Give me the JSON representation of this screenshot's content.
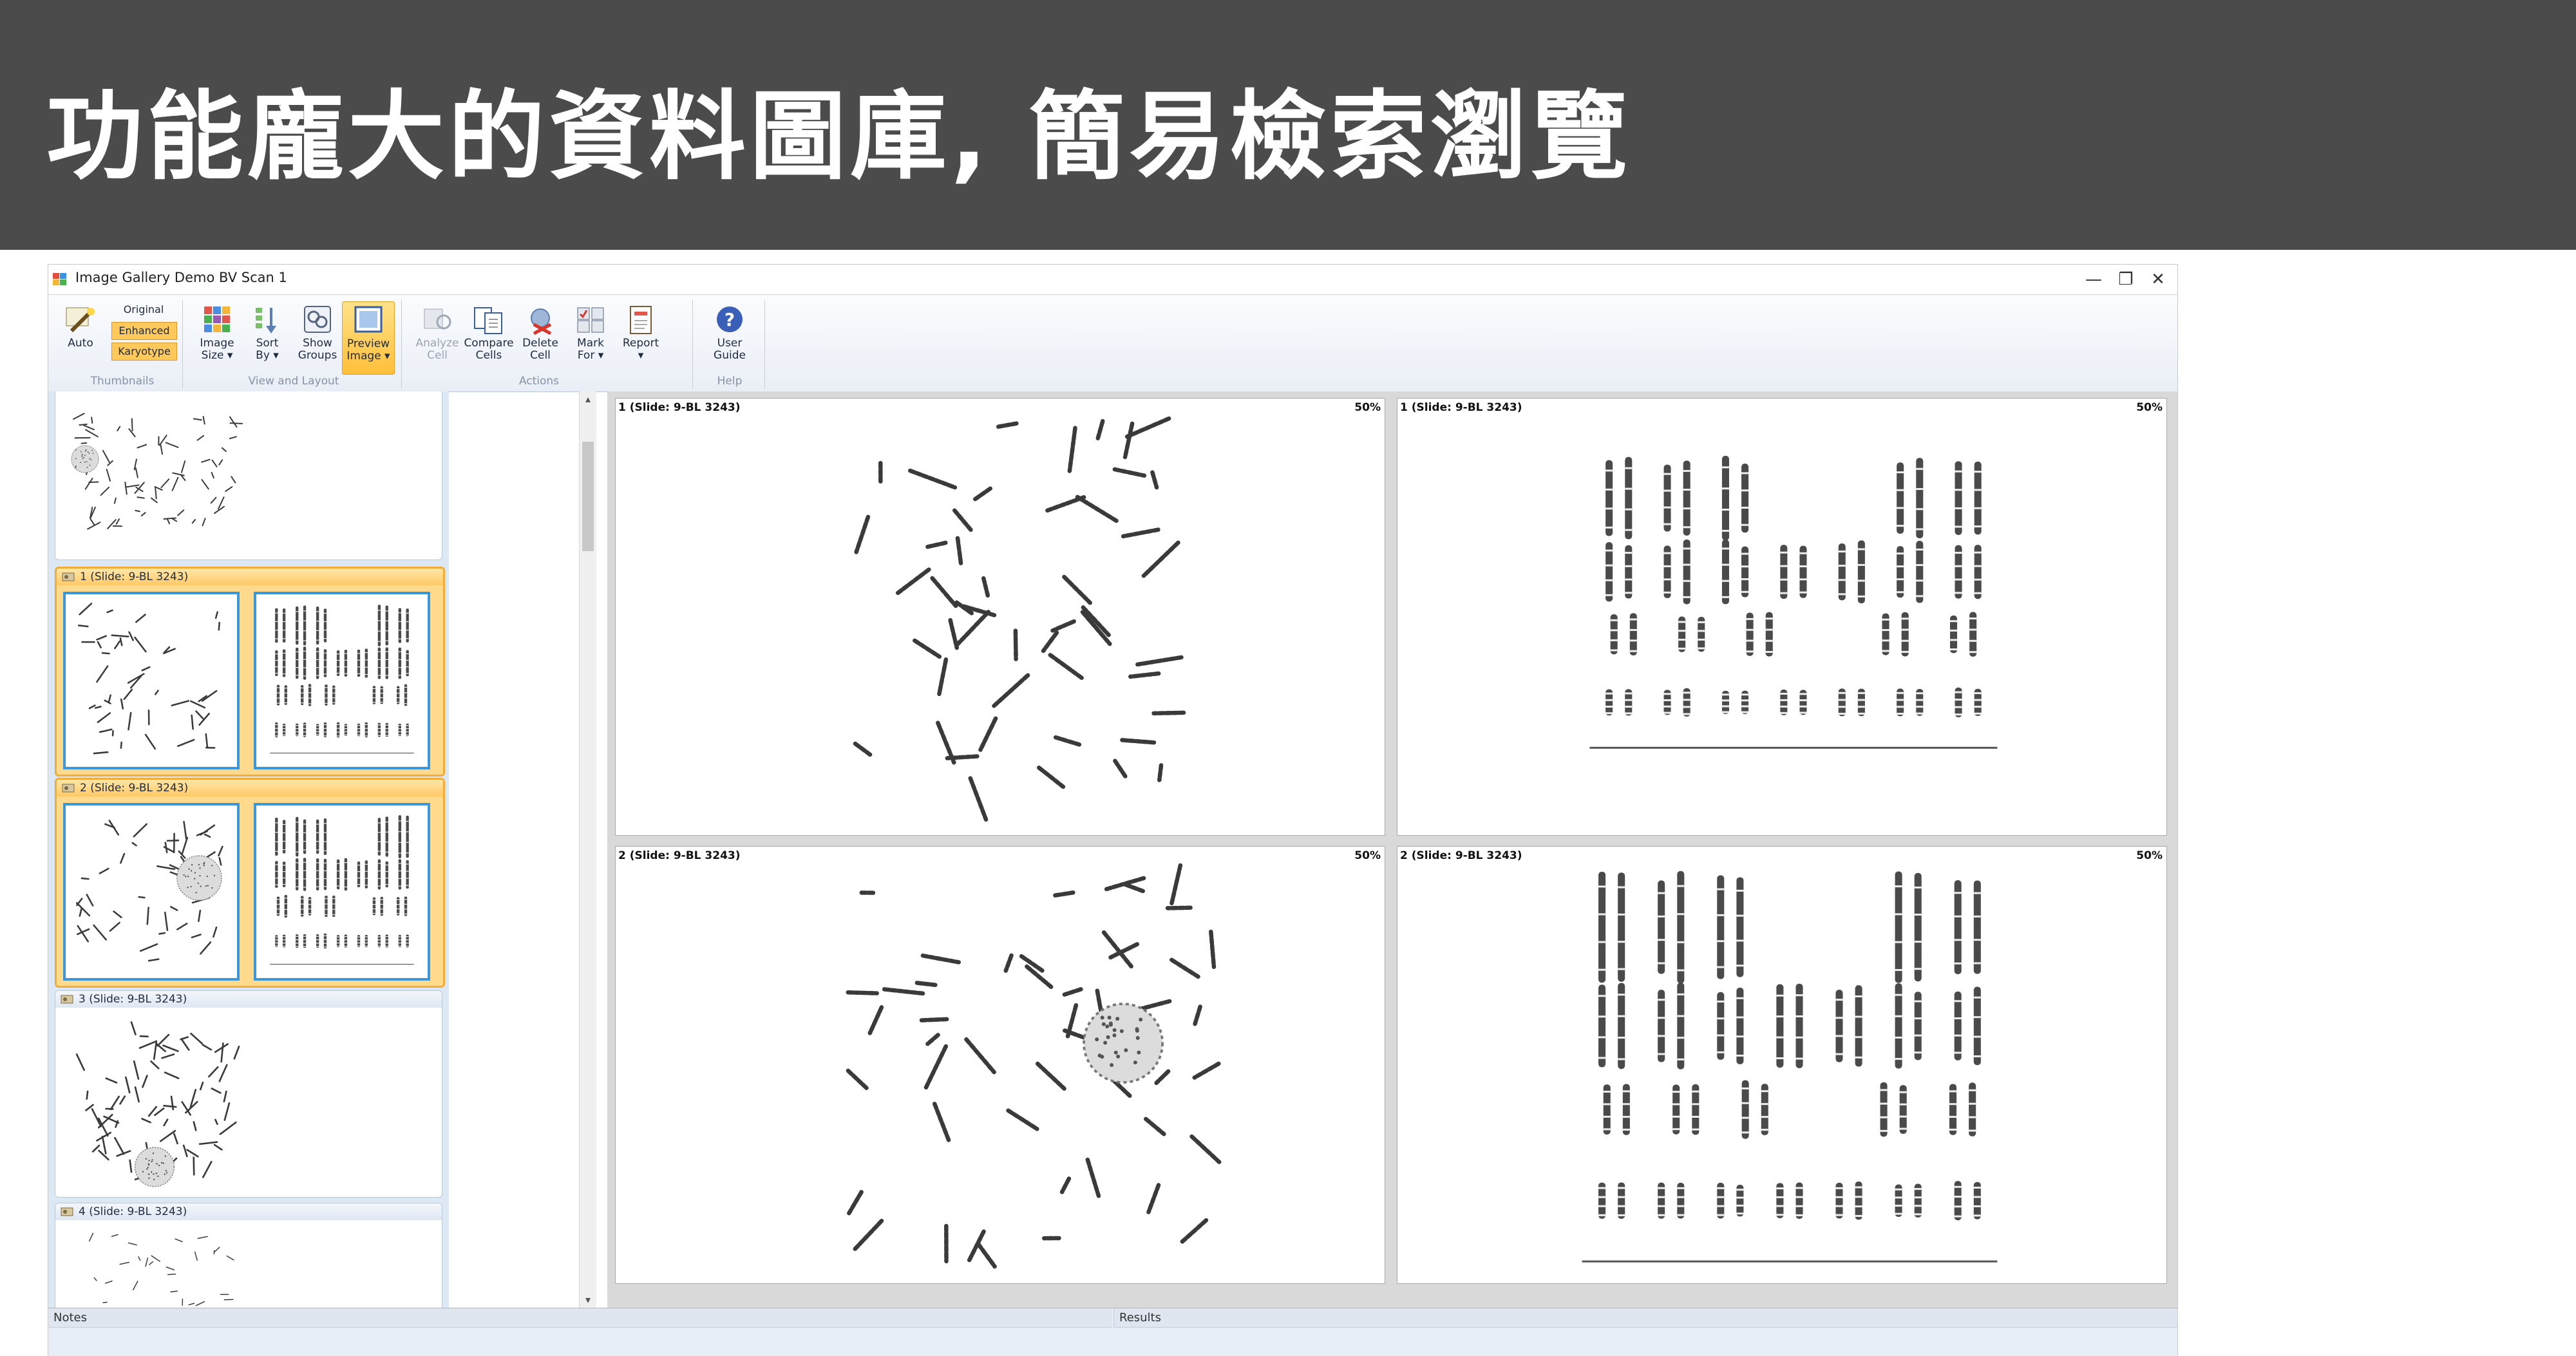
{
  "banner": {
    "title": "功能龐大的資料圖庫, 簡易檢索瀏覽"
  },
  "window": {
    "title": "Image Gallery Demo BV Scan 1",
    "controls": {
      "minimize": "—",
      "restore": "❐",
      "close": "✕"
    }
  },
  "ribbon": {
    "thumbnails": {
      "group_label": "Thumbnails",
      "auto_label": "Auto",
      "options": [
        "Original",
        "Enhanced",
        "Karyotype"
      ],
      "selected": [
        "Enhanced",
        "Karyotype"
      ]
    },
    "view_layout": {
      "group_label": "View and Layout",
      "image_size": "Image\nSize ▾",
      "sort_by": "Sort\nBy ▾",
      "show_groups": "Show\nGroups",
      "preview_image": "Preview\nImage ▾"
    },
    "actions": {
      "group_label": "Actions",
      "analyze_cell": "Analyze\nCell",
      "compare_cells": "Compare\nCells",
      "delete_cell": "Delete\nCell",
      "mark_for": "Mark\nFor ▾",
      "report": "Report\n▾"
    },
    "help": {
      "group_label": "Help",
      "user_guide": "User\nGuide"
    }
  },
  "gallery": {
    "cards": [
      {
        "label": ""
      },
      {
        "label": "1 (Slide: 9-BL 3243)",
        "selected": true
      },
      {
        "label": "2 (Slide: 9-BL 3243)",
        "selected": true
      },
      {
        "label": "3 (Slide: 9-BL 3243)",
        "selected": false
      },
      {
        "label": "4 (Slide: 9-BL 3243)",
        "selected": false
      }
    ]
  },
  "preview": {
    "panes": [
      {
        "label": "1 (Slide: 9-BL 3243)",
        "zoom": "50%"
      },
      {
        "label": "1 (Slide: 9-BL 3243)",
        "zoom": "50%"
      },
      {
        "label": "2 (Slide: 9-BL 3243)",
        "zoom": "50%"
      },
      {
        "label": "2 (Slide: 9-BL 3243)",
        "zoom": "50%"
      }
    ]
  },
  "bottom": {
    "notes_label": "Notes",
    "results_label": "Results"
  },
  "colors": {
    "banner": "#4b4b4b",
    "selection": "#f2ac37",
    "thumb_border": "#3b97d8",
    "panel": "#dde8f5"
  }
}
